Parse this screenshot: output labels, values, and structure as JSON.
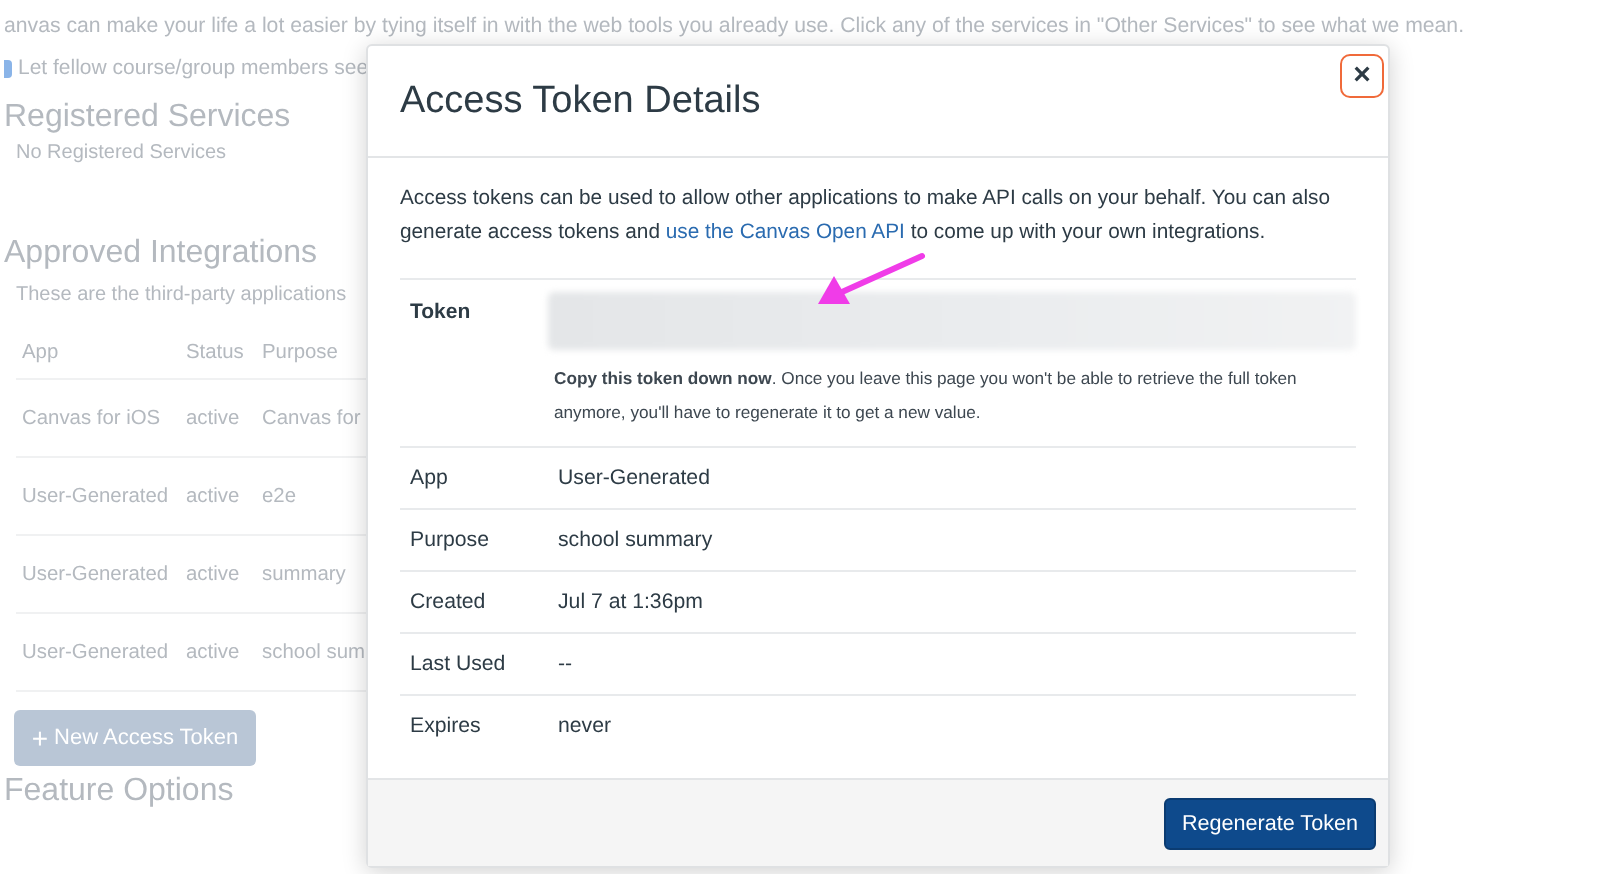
{
  "page": {
    "intro": "anvas can make your life a lot easier by tying itself in with the web tools you already use. Click any of the services in \"Other Services\" to see what we mean.",
    "share_option": {
      "label": "Let fellow course/group members see",
      "checked": true
    },
    "registered": {
      "title": "Registered Services",
      "empty": "No Registered Services"
    },
    "approved": {
      "title": "Approved Integrations",
      "subtitle": "These are the third-party applications",
      "columns": [
        "App",
        "Status",
        "Purpose"
      ],
      "rows": [
        [
          "Canvas for iOS",
          "active",
          "Canvas for"
        ],
        [
          "User-Generated",
          "active",
          "e2e"
        ],
        [
          "User-Generated",
          "active",
          "summary"
        ],
        [
          "User-Generated",
          "active",
          "school sum"
        ]
      ],
      "new_button": {
        "icon": "+",
        "label": "New Access Token"
      }
    },
    "feature_title": "Feature Options"
  },
  "dialog": {
    "title": "Access Token Details",
    "close": "×",
    "description": "Access tokens can be used to allow other applications to make API calls on your behalf. You can also generate access tokens and ",
    "link": "use the Canvas Open API",
    "description_end": " to come up with your own integrations.",
    "token_label": "Token",
    "token_note": "**Copy this token down now**. Once you leave this page you won't be able to retrieve the full token anymore, you'll have to regenerate it to get a new value.",
    "details": [
      {
        "label": "App",
        "value": "User-Generated"
      },
      {
        "label": "Purpose",
        "value": "school summary"
      },
      {
        "label": "Created",
        "value": "Jul 7 at 1:36pm"
      },
      {
        "label": "Last Used",
        "value": "--"
      },
      {
        "label": "Expires",
        "value": "never"
      }
    ],
    "regenerate_button": "Regenerate Token"
  }
}
